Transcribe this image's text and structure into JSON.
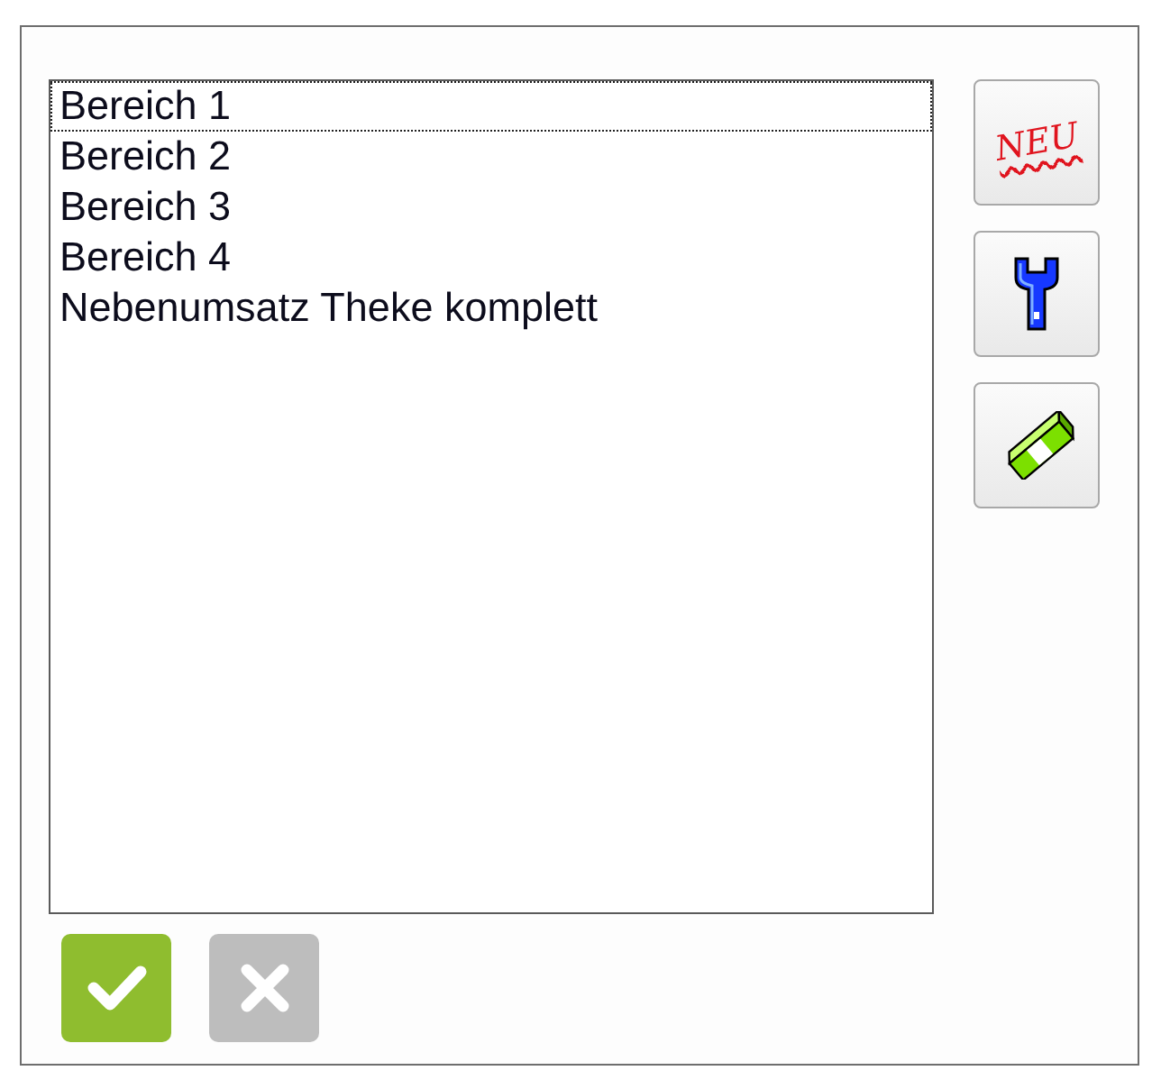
{
  "list": {
    "items": [
      {
        "label": "Bereich 1",
        "focused": true
      },
      {
        "label": "Bereich 2",
        "focused": false
      },
      {
        "label": "Bereich 3",
        "focused": false
      },
      {
        "label": "Bereich 4",
        "focused": false
      },
      {
        "label": "Nebenumsatz Theke komplett",
        "focused": false
      }
    ]
  },
  "tool_buttons": [
    {
      "kind": "new",
      "label": "NEU"
    },
    {
      "kind": "edit"
    },
    {
      "kind": "erase"
    }
  ],
  "action_buttons": [
    {
      "kind": "confirm",
      "disabled": false
    },
    {
      "kind": "cancel",
      "disabled": true
    }
  ]
}
